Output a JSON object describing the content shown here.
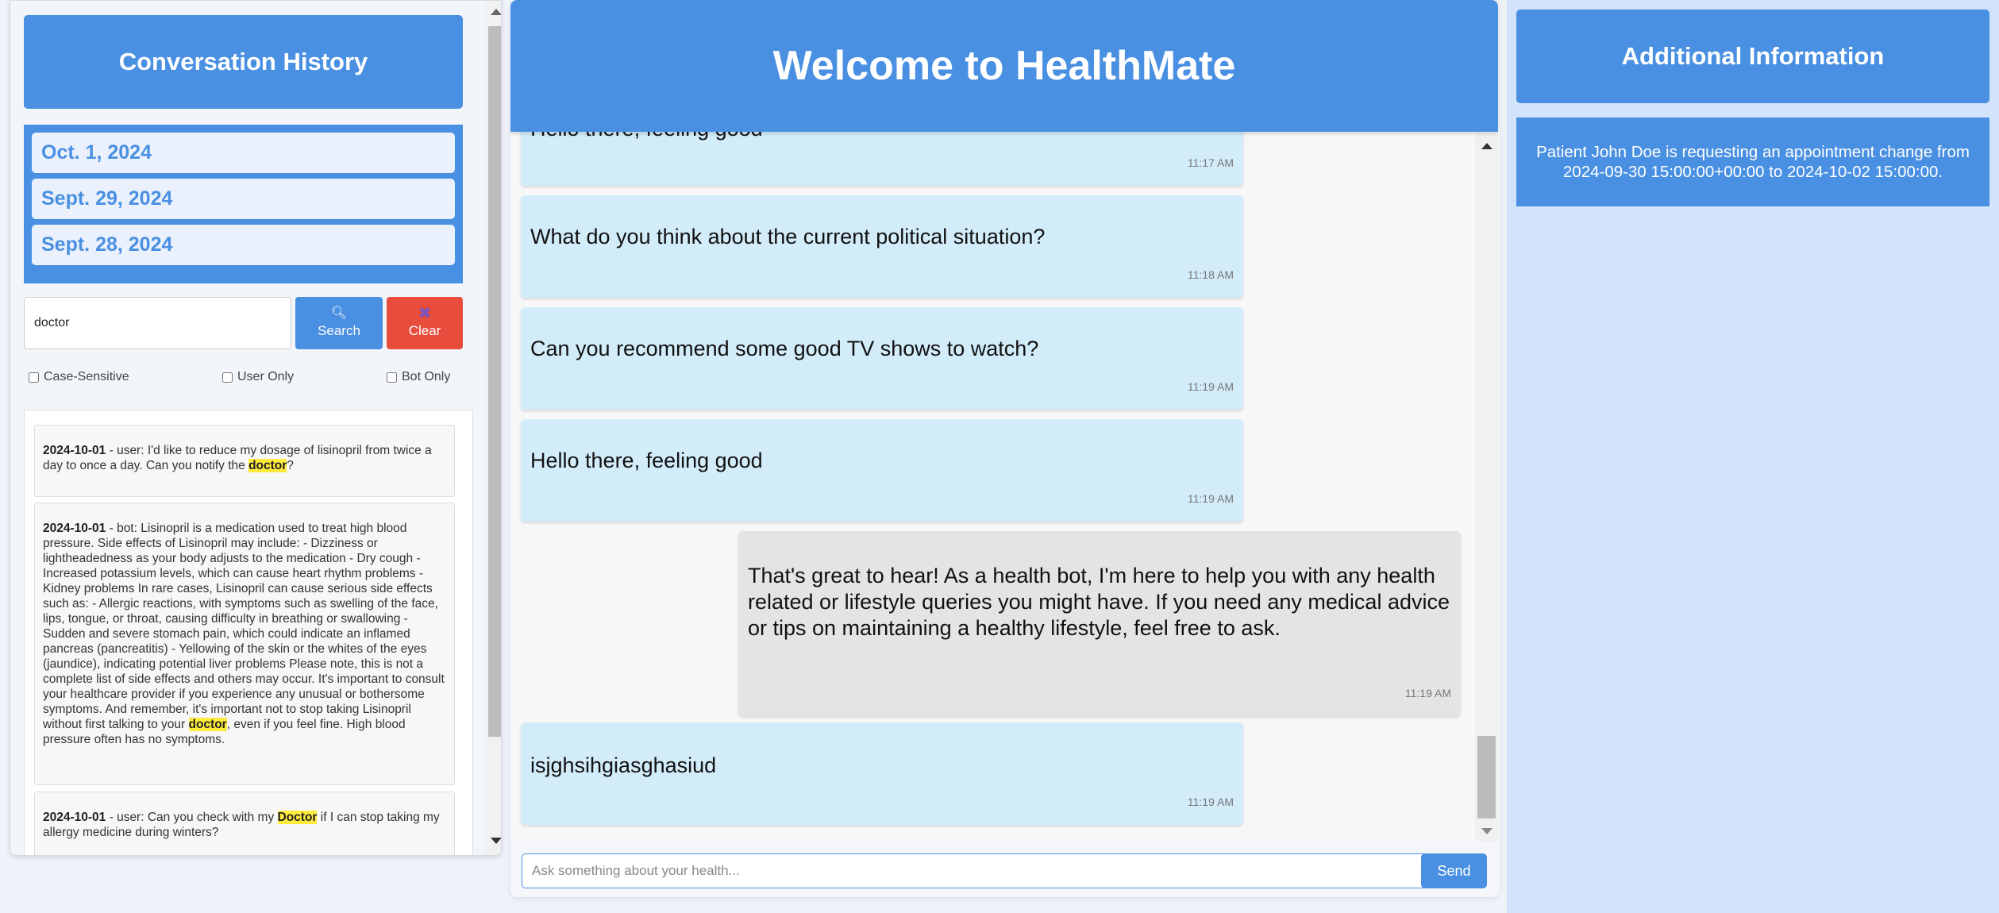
{
  "history": {
    "title": "Conversation History",
    "dates": [
      "Oct. 1, 2024",
      "Sept. 29, 2024",
      "Sept. 28, 2024"
    ],
    "search": {
      "value": "doctor",
      "placeholder": ""
    },
    "search_label": "Search",
    "clear_label": "Clear",
    "filters": {
      "case_sensitive": "Case-Sensitive",
      "user_only": "User Only",
      "bot_only": "Bot Only"
    },
    "results": [
      {
        "date": "2024-10-01",
        "before": " - user: I'd like to reduce my dosage of lisinopril from twice a day to once a day. Can you notify the ",
        "match": "doctor",
        "after": "?"
      },
      {
        "date": "2024-10-01",
        "before": " - bot: Lisinopril is a medication used to treat high blood pressure. Side effects of Lisinopril may include: - Dizziness or lightheadedness as your body adjusts to the medication - Dry cough - Increased potassium levels, which can cause heart rhythm problems - Kidney problems In rare cases, Lisinopril can cause serious side effects such as: - Allergic reactions, with symptoms such as swelling of the face, lips, tongue, or throat, causing difficulty in breathing or swallowing - Sudden and severe stomach pain, which could indicate an inflamed pancreas (pancreatitis) - Yellowing of the skin or the whites of the eyes (jaundice), indicating potential liver problems Please note, this is not a complete list of side effects and others may occur. It's important to consult your healthcare provider if you experience any unusual or bothersome symptoms. And remember, it's important not to stop taking Lisinopril without first talking to your ",
        "match": "doctor",
        "after": ", even if you feel fine. High blood pressure often has no symptoms."
      },
      {
        "date": "2024-10-01",
        "before": " - user: Can you check with my ",
        "match": "Doctor",
        "after": " if I can stop taking my allergy medicine during winters?"
      }
    ]
  },
  "chat": {
    "title": "Welcome to HealthMate",
    "messages": [
      {
        "sender": "user",
        "text": "Hello there, feeling good",
        "time": "11:17 AM"
      },
      {
        "sender": "user",
        "text": "What do you think about the current political situation?",
        "time": "11:18 AM"
      },
      {
        "sender": "user",
        "text": "Can you recommend some good TV shows to watch?",
        "time": "11:19 AM"
      },
      {
        "sender": "user",
        "text": "Hello there, feeling good",
        "time": "11:19 AM"
      },
      {
        "sender": "bot",
        "text": "That's great to hear! As a health bot, I'm here to help you with any health related or lifestyle queries you might have. If you need any medical advice or tips on maintaining a healthy lifestyle, feel free to ask.",
        "time": "11:19 AM"
      },
      {
        "sender": "user",
        "text": "isjghsihgiasghasiud",
        "time": "11:19 AM"
      }
    ],
    "input": {
      "value": "",
      "placeholder": "Ask something about your health..."
    },
    "send_label": "Send"
  },
  "info": {
    "title": "Additional Information",
    "text": "Patient John Doe is requesting an appointment change from 2024-09-30 15:00:00+00:00 to 2024-10-02 15:00:00."
  },
  "icons": {
    "search": "magnifier-icon",
    "clear": "x-icon"
  },
  "colors": {
    "accent": "#4a90e2",
    "danger": "#e74c3c",
    "user_bubble": "#d2ecfa",
    "bot_bubble": "#e3e4e6",
    "highlight": "#ffeb3b"
  }
}
